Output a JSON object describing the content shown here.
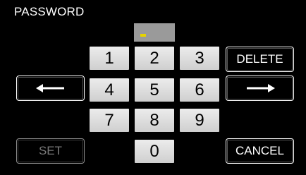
{
  "dialog": {
    "title": "PASSWORD"
  },
  "password_field": {
    "value": "",
    "cursor_color": "#e6d400"
  },
  "keypad": {
    "keys": [
      "1",
      "2",
      "3",
      "4",
      "5",
      "6",
      "7",
      "8",
      "9",
      "0"
    ]
  },
  "buttons": {
    "delete_label": "DELETE",
    "set_label": "SET",
    "cancel_label": "CANCEL",
    "left_icon": "arrow-left-icon",
    "right_icon": "arrow-right-icon",
    "set_enabled": false
  },
  "colors": {
    "background": "#000000",
    "key_face": "#dcdcdc",
    "field": "#9a9a9a"
  }
}
